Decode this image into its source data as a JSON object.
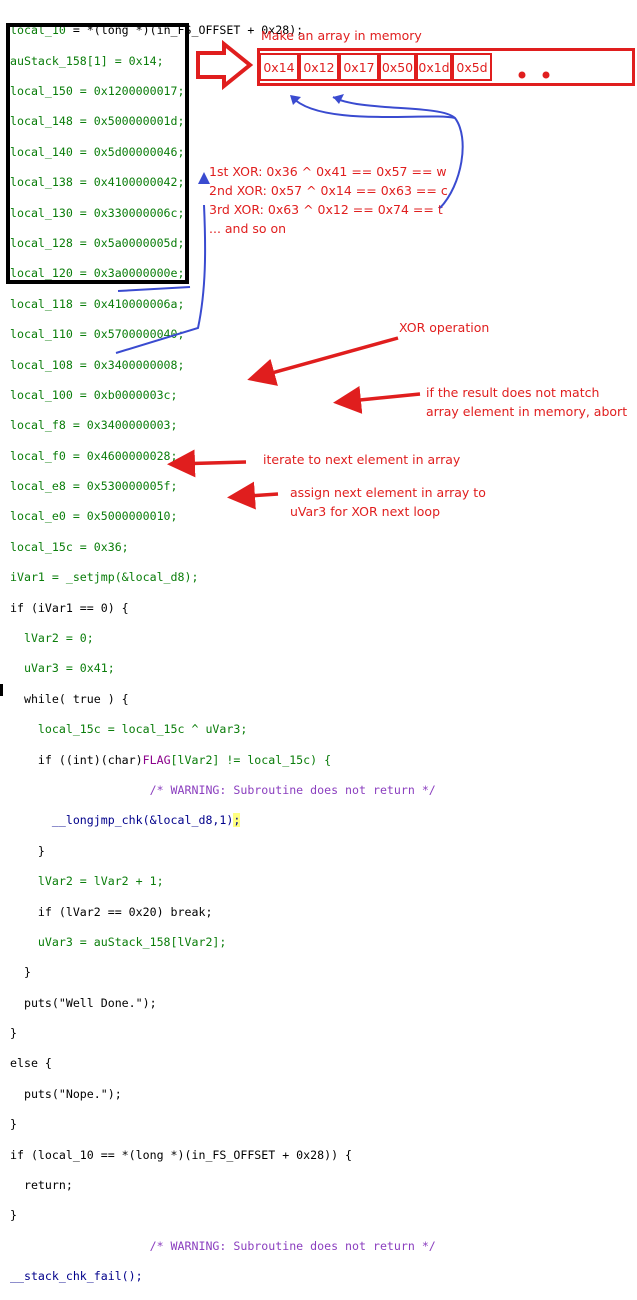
{
  "code": {
    "line1": {
      "a": "local_10",
      "b": " = *(long *)(in_FS_OFFSET + 0x28);"
    },
    "arr": [
      "auStack_158[1] = 0x14;",
      "local_150 = 0x1200000017;",
      "local_148 = 0x500000001d;",
      "local_140 = 0x5d00000046;",
      "local_138 = 0x4100000042;",
      "local_130 = 0x330000006c;",
      "local_128 = 0x5a0000005d;",
      "local_120 = 0x3a0000000e;",
      "local_118 = 0x410000006a;",
      "local_110 = 0x5700000040;",
      "local_108 = 0x3400000008;",
      "local_100 = 0xb0000003c;",
      "local_f8 = 0x3400000003;",
      "local_f0 = 0x4600000028;",
      "local_e8 = 0x530000005f;",
      "local_e0 = 0x5000000010;"
    ],
    "l18": "local_15c = 0x36;",
    "l19": "iVar1 = _setjmp(&local_d8);",
    "l20": "if (iVar1 == 0) {",
    "l21": "  lVar2 = 0;",
    "l22": "  uVar3 = 0x41;",
    "l23": "  while( true ) {",
    "l24": "    local_15c = local_15c ^ uVar3;",
    "l25a": "    if ((int)(char)",
    "l25b": "FLAG",
    "l25c": "[lVar2] != local_15c) {",
    "l26": "                    /* WARNING: Subroutine does not return */",
    "l27a": "      __longjmp_chk(&local_d8,1)",
    "l27b": ";",
    "l28": "    }",
    "l29": "    lVar2 = lVar2 + 1;",
    "l30": "    if (lVar2 == 0x20) break;",
    "l31": "    uVar3 = auStack_158[lVar2];",
    "l32": "  }",
    "l33": "  puts(\"Well Done.\");",
    "l34": "}",
    "l35": "else {",
    "l36": "  puts(\"Nope.\");",
    "l37": "}",
    "l38": "if (local_10 == *(long *)(in_FS_OFFSET + 0x28)) {",
    "l39": "  return;",
    "l40": "}",
    "l41": "                    /* WARNING: Subroutine does not return */",
    "l42": "__stack_chk_fail();"
  },
  "annotations": {
    "memory_title": "Make an array in memory",
    "memory_cells": [
      "0x14",
      "0x12",
      "0x17",
      "0x50",
      "0x1d",
      "0x5d"
    ],
    "xor1": "1st XOR: 0x36 ^ 0x41 == 0x57 == w",
    "xor2": "2nd XOR: 0x57 ^ 0x14 == 0x63 == c",
    "xor3": "3rd XOR: 0x63 ^ 0x12 == 0x74 == t",
    "xor_more": "... and so on",
    "xor_op": "XOR operation",
    "mismatch1": "if the result does not match",
    "mismatch2": "array element in memory, abort",
    "iterate": "iterate to next element in array",
    "assign1": "assign next element in array to",
    "assign2": "uVar3 for XOR next loop"
  },
  "colors": {
    "annotation": "#e01e1e",
    "arrow_blue": "#3a4bd0",
    "box": "#000000"
  }
}
